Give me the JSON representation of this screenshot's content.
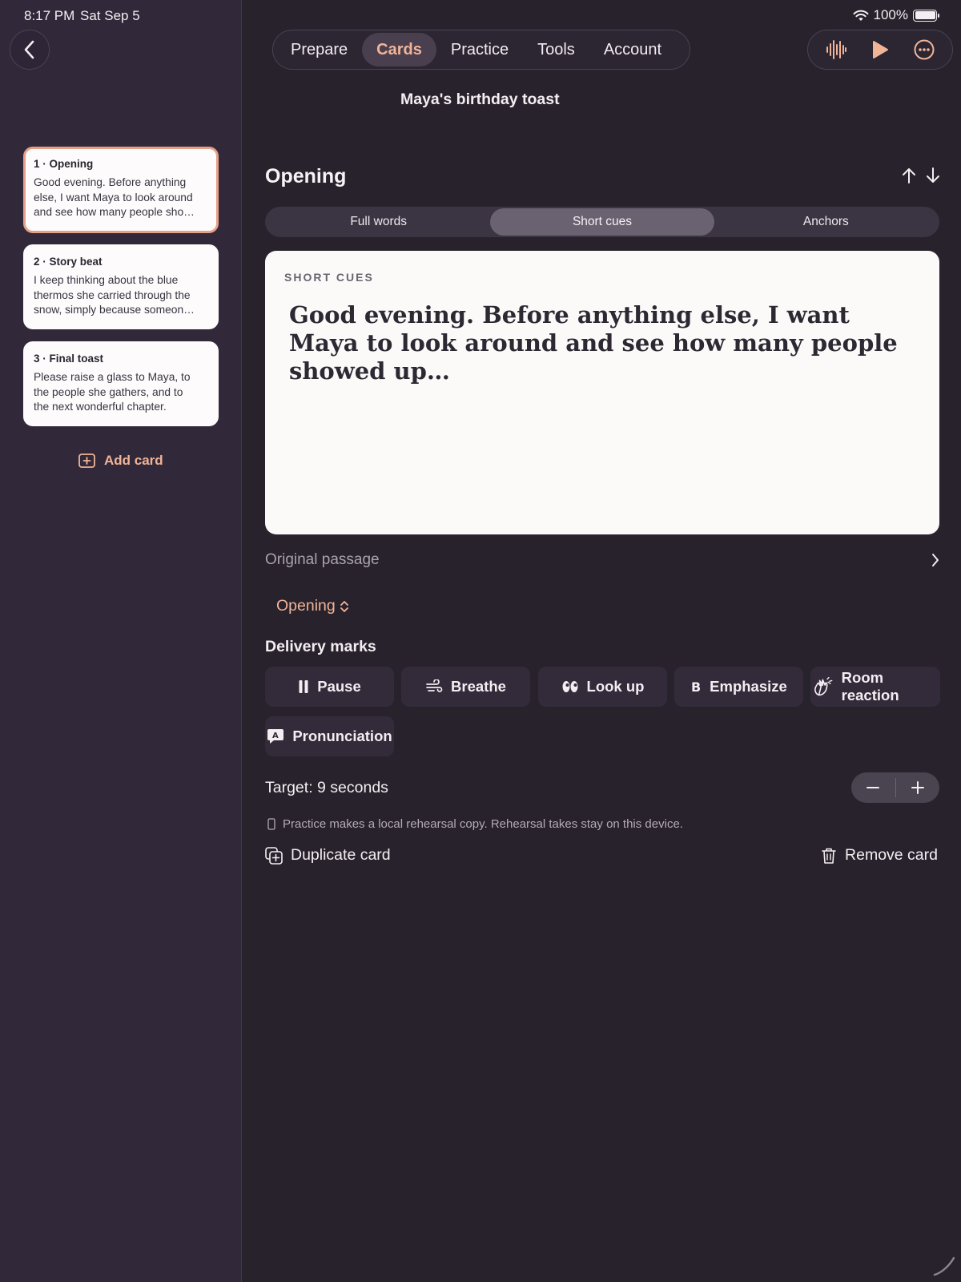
{
  "status_bar": {
    "time": "8:17 PM",
    "date": "Sat Sep 5",
    "battery": "100%",
    "battery_level": 1.0
  },
  "nav": {
    "tabs": [
      {
        "label": "Prepare",
        "active": false
      },
      {
        "label": "Cards",
        "active": true
      },
      {
        "label": "Practice",
        "active": false
      },
      {
        "label": "Tools",
        "active": false
      },
      {
        "label": "Account",
        "active": false
      }
    ],
    "actions": [
      "waveform-icon",
      "play-icon",
      "more-icon"
    ]
  },
  "document_title": "Maya's birthday toast",
  "sidebar": {
    "cards": [
      {
        "title": "1 · Opening",
        "body": "Good evening. Before anything\nelse, I want Maya to look around\nand see how many people sho…",
        "selected": true
      },
      {
        "title": "2 · Story beat",
        "body": "I keep thinking about the blue\nthermos she carried through the\nsnow, simply because someon…",
        "selected": false
      },
      {
        "title": "3 · Final toast",
        "body": "Please raise a glass to Maya, to\nthe people she gathers, and to\nthe next wonderful chapter.",
        "selected": false
      }
    ],
    "add_card_label": "Add card"
  },
  "editor": {
    "section_title": "Opening",
    "modes": [
      {
        "label": "Full words",
        "active": false
      },
      {
        "label": "Short cues",
        "active": true
      },
      {
        "label": "Anchors",
        "active": false
      }
    ],
    "sheet_label": "SHORT CUES",
    "sheet_text": "Good evening. Before anything else, I want Maya to look around and see how many people showed up…",
    "original_passage_label": "Original passage",
    "section_picker_value": "Opening",
    "delivery_marks_label": "Delivery marks",
    "delivery_marks": [
      {
        "label": "Pause",
        "icon": "pause-icon"
      },
      {
        "label": "Breathe",
        "icon": "wind-icon"
      },
      {
        "label": "Look up",
        "icon": "eyes-icon"
      },
      {
        "label": "Emphasize",
        "icon": "bold-icon"
      },
      {
        "label": "Room reaction",
        "icon": "applause-icon"
      },
      {
        "label": "Pronunciation",
        "icon": "pronunciation-icon"
      }
    ],
    "target_label": "Target: 9 seconds",
    "privacy_note": "Practice makes a local rehearsal copy. Rehearsal takes stay on this device.",
    "duplicate_label": "Duplicate card",
    "remove_label": "Remove card"
  },
  "colors": {
    "accent": "#f1b497",
    "background": "#28222d",
    "sidebar": "#312839",
    "card": "#fdfbfb"
  }
}
